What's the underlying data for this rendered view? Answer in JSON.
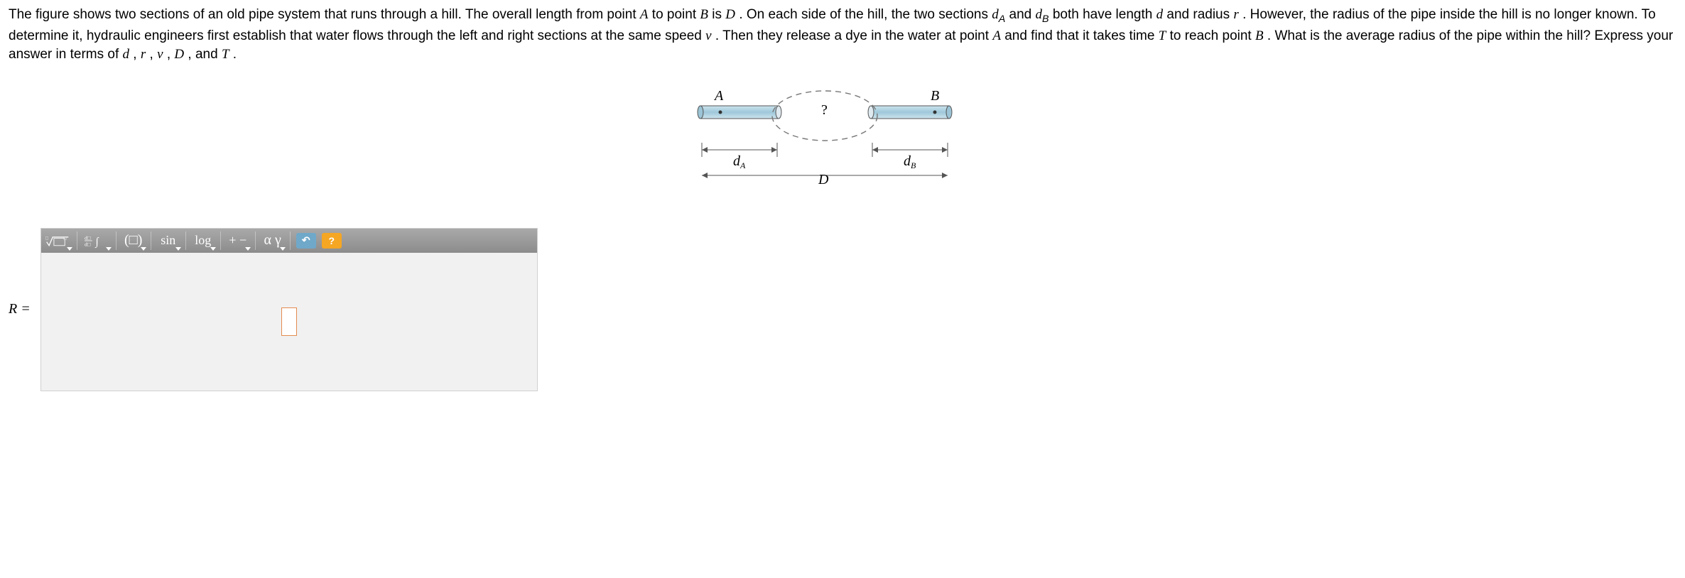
{
  "problem": {
    "text_parts": [
      "The figure shows two sections of an old pipe system that runs through a hill. The overall length from point ",
      " to point ",
      " is ",
      ". On each side of the hill, the two sections ",
      " and ",
      " both have length ",
      " and radius ",
      ". However, the radius of the pipe inside the hill is no longer known. To determine it, hydraulic engineers first establish that water flows through the left and right sections at the same speed ",
      ". Then they release a dye in the water at point ",
      " and find that it takes time ",
      " to reach point ",
      ". What is the average radius of the pipe within the hill? Express your answer in terms of ",
      ", ",
      ", ",
      ", ",
      ", and ",
      "."
    ],
    "vars": {
      "A": "A",
      "B": "B",
      "D": "D",
      "dA": "d",
      "dA_sub": "A",
      "dB": "d",
      "dB_sub": "B",
      "d": "d",
      "r": "r",
      "v": "v",
      "T": "T"
    }
  },
  "diagram": {
    "A": "A",
    "B": "B",
    "q": "?",
    "dA": "d",
    "dA_sub": "A",
    "dB": "d",
    "dB_sub": "B",
    "D": "D"
  },
  "answer": {
    "label": "R ="
  },
  "toolbar": {
    "root_label": "√",
    "frac_label": "d□/d□",
    "paren_label": "(□)",
    "sin_label": "sin",
    "log_label": "log",
    "pm_label": "+ −",
    "greek_label": "α γ",
    "undo_label": "↶",
    "help_label": "?"
  }
}
